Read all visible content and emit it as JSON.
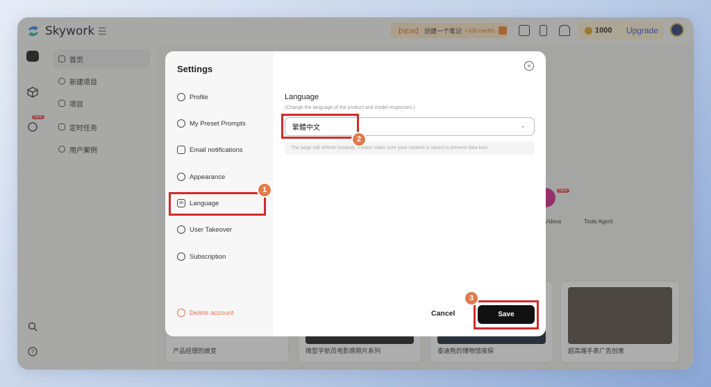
{
  "app": {
    "name": "Skywork"
  },
  "topbar": {
    "promo_tag": "【NEW】",
    "promo_text": "创建一个笔记",
    "promo_credits": "+100 credits",
    "coins": "1000",
    "upgrade_label": "Upgrade"
  },
  "rail": {
    "new_badge": "New"
  },
  "sidenav": {
    "items": [
      {
        "label": "首页"
      },
      {
        "label": "新建项目"
      },
      {
        "label": "项目"
      },
      {
        "label": "定时任务"
      },
      {
        "label": "用户案例"
      }
    ]
  },
  "background": {
    "cards": [
      "产品经理的蜕变",
      "微型宇航员电影感照片系列",
      "泰迪熊的博物馆夜探",
      "超高端手表广告创意"
    ],
    "tools_agent": "Tools Agent",
    "videos": "Videos",
    "videos_badge": "New"
  },
  "settings": {
    "title": "Settings",
    "menu": [
      {
        "label": "Profile"
      },
      {
        "label": "My Preset Prompts"
      },
      {
        "label": "Email notifications"
      },
      {
        "label": "Appearance"
      },
      {
        "label": "Language",
        "icon_text": "zh"
      },
      {
        "label": "User Takeover"
      },
      {
        "label": "Subscription"
      }
    ],
    "delete_label": "Delete account",
    "language": {
      "title": "Language",
      "description": "(Change the language of the product and model responses.)",
      "selected": "繁體中文",
      "note": "The page will refresh instantly. Please make sure your content is saved to prevent data loss."
    },
    "cancel_label": "Cancel",
    "save_label": "Save"
  },
  "steps": [
    "1",
    "2",
    "3"
  ],
  "colors": {
    "highlight": "#d32a2a",
    "step_badge": "#e07b4c",
    "accent": "#3f55d8",
    "danger": "#e8734f"
  }
}
